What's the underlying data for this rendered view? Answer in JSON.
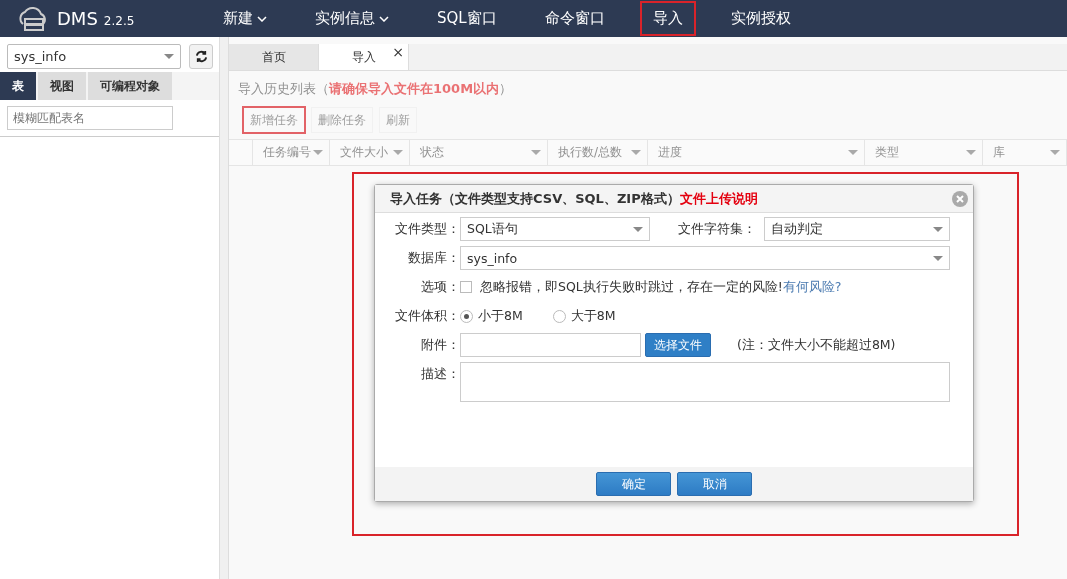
{
  "app": {
    "name": "DMS",
    "version": "2.2.5"
  },
  "nav": [
    {
      "label": "新建",
      "dropdown": true,
      "highlighted": false
    },
    {
      "label": "实例信息",
      "dropdown": true,
      "highlighted": false
    },
    {
      "label": "SQL窗口",
      "dropdown": false,
      "highlighted": false
    },
    {
      "label": "命令窗口",
      "dropdown": false,
      "highlighted": false
    },
    {
      "label": "导入",
      "dropdown": false,
      "highlighted": true
    },
    {
      "label": "实例授权",
      "dropdown": false,
      "highlighted": false
    }
  ],
  "sidebar": {
    "database": "sys_info",
    "tabs": [
      {
        "label": "表",
        "selected": true
      },
      {
        "label": "视图",
        "selected": false
      },
      {
        "label": "可编程对象",
        "selected": false
      }
    ],
    "search_placeholder": "模糊匹配表名"
  },
  "tabs": [
    {
      "label": "首页",
      "selected": false
    },
    {
      "label": "导入",
      "selected": true,
      "close_glyph": "×"
    }
  ],
  "page": {
    "title": "导入历史列表（",
    "note": "请确保导入文件在100M以内",
    "title_end": "）",
    "toolbar": [
      {
        "label": "新增任务",
        "highlighted": true
      },
      {
        "label": "删除任务",
        "highlighted": false
      },
      {
        "label": "刷新",
        "highlighted": false
      }
    ],
    "columns": [
      "任务编号",
      "文件大小",
      "状态",
      "执行数/总数",
      "进度",
      "类型",
      "库"
    ]
  },
  "dialog": {
    "title": "导入任务（文件类型支持CSV、SQL、ZIP格式）",
    "help_link": "文件上传说明",
    "highlighted": true,
    "file_type_label": "文件类型：",
    "file_type": "SQL语句",
    "charset_label": "文件字符集：",
    "charset": "自动判定",
    "database_label": "数据库：",
    "database": "sys_info",
    "option_label": "选项：",
    "ignore_errors": {
      "label": "忽略报错，即SQL执行失败时跳过，存在一定的风险!",
      "checked": false
    },
    "risk_link": "有何风险?",
    "size_label": "文件体积：",
    "sizes": [
      {
        "label": "小于8M",
        "selected": true
      },
      {
        "label": "大于8M",
        "selected": false
      }
    ],
    "attachment_label": "附件：",
    "choose_file": "选择文件",
    "attachment_note": "(注：文件大小不能超过8M)",
    "description_label": "描述：",
    "buttons": [
      "确定",
      "取消"
    ]
  }
}
